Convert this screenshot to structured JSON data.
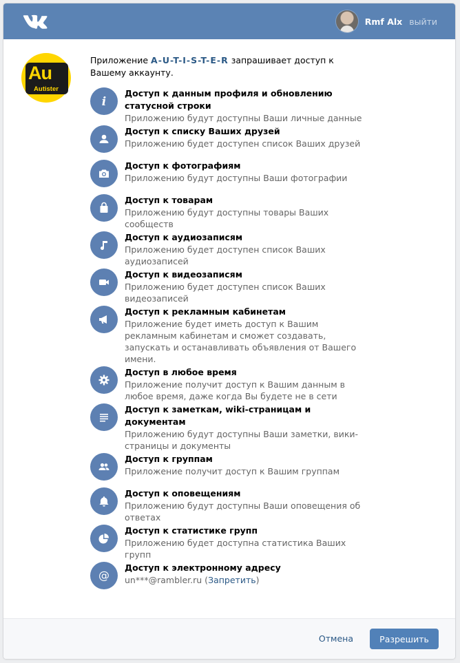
{
  "header": {
    "logo_icon": "vk-logo-icon",
    "user_name": "Rmf Alx",
    "logout_label": "выйти"
  },
  "app": {
    "logo_text": "Au",
    "logo_subtext": "Autister",
    "intro_before": "Приложение",
    "name": "A-U-T-I-S-T-E-R",
    "intro_after": "запрашивает доступ к Вашему аккаунту."
  },
  "permissions": [
    {
      "icon": "info-icon",
      "title": "Доступ к данным профиля и обновлению статусной строки",
      "desc": "Приложению будут доступны Ваши личные данные"
    },
    {
      "icon": "person-icon",
      "title": "Доступ к списку Ваших друзей",
      "desc": "Приложению будет доступен список Ваших друзей"
    },
    {
      "icon": "camera-icon",
      "title": "Доступ к фотографиям",
      "desc": "Приложению будут доступны Ваши фотографии"
    },
    {
      "icon": "shopping-bag-icon",
      "title": "Доступ к товарам",
      "desc": "Приложению будут доступны товары Ваших сообществ"
    },
    {
      "icon": "music-note-icon",
      "title": "Доступ к аудиозаписям",
      "desc": "Приложению будет доступен список Ваших аудиозаписей"
    },
    {
      "icon": "video-camera-icon",
      "title": "Доступ к видеозаписям",
      "desc": "Приложению будет доступен список Ваших видеозаписей"
    },
    {
      "icon": "megaphone-icon",
      "title": "Доступ к рекламным кабинетам",
      "desc": "Приложение будет иметь доступ к Вашим рекламным кабинетам и сможет создавать, запускать и останавливать объявления от Вашего имени."
    },
    {
      "icon": "gear-icon",
      "title": "Доступ в любое время",
      "desc": "Приложение получит доступ к Вашим данным в любое время, даже когда Вы будете не в сети"
    },
    {
      "icon": "document-lines-icon",
      "title": "Доступ к заметкам, wiki-страницам и документам",
      "desc": "Приложению будут доступны Ваши заметки, вики-страницы и документы"
    },
    {
      "icon": "group-icon",
      "title": "Доступ к группам",
      "desc": "Приложение получит доступ к Вашим группам"
    },
    {
      "icon": "bell-icon",
      "title": "Доступ к оповещениям",
      "desc": "Приложению будут доступны Ваши оповещения об ответах"
    },
    {
      "icon": "pie-chart-icon",
      "title": "Доступ к статистике групп",
      "desc": "Приложению будет доступна статистика Ваших групп"
    }
  ],
  "email_permission": {
    "icon": "at-sign-icon",
    "title": "Доступ к электронному адресу",
    "email": "un***@rambler.ru",
    "deny_label": "Запретить"
  },
  "footer": {
    "cancel_label": "Отмена",
    "allow_label": "Разрешить"
  },
  "colors": {
    "header": "#5b83b4",
    "icon_bg": "#5d80b2",
    "link": "#2a5885",
    "primary_button": "#5181b8",
    "app_logo": "#ffd600"
  }
}
